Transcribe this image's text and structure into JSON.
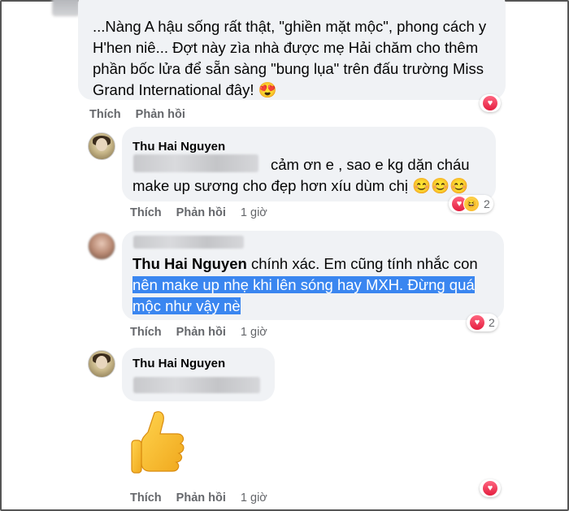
{
  "comment1": {
    "text": "...Nàng A hậu sống rất thật, \"ghiền mặt mộc\", phong cách y H'hen niê... Đợt này zìa nhà được mẹ Hải chăm cho thêm phần bốc lửa để sẵn sàng \"bung lụa\" trên đấu trường Miss Grand International đây! 😍",
    "like_label": "Thích",
    "reply_label": "Phản hồi"
  },
  "comment2": {
    "author": "Thu Hai Nguyen",
    "text": "cảm ơn e , sao e kg dặn cháu make up sương cho đẹp hơn xíu dùm chị 😊😊😊",
    "like_label": "Thích",
    "reply_label": "Phản hồi",
    "time": "1 giờ",
    "reaction_count": "2"
  },
  "comment3": {
    "tag": "Thu Hai Nguyen",
    "text_before": "chính xác. Em cũng tính nhắc con",
    "text_highlight_1": "nên make up nhẹ khi lên sóng hay MXH. Đừng quá",
    "text_highlight_2": "mộc như vậy nè",
    "like_label": "Thích",
    "reply_label": "Phản hồi",
    "time": "1 giờ",
    "reaction_count": "2"
  },
  "comment4": {
    "author": "Thu Hai Nguyen",
    "sticker": "thumbs-up",
    "like_label": "Thích",
    "reply_label": "Phản hồi",
    "time": "1 giờ"
  },
  "colors": {
    "bubble": "#f0f2f5",
    "highlight": "#3a86f0",
    "action": "#65676b",
    "heart": "#e41e3f"
  }
}
